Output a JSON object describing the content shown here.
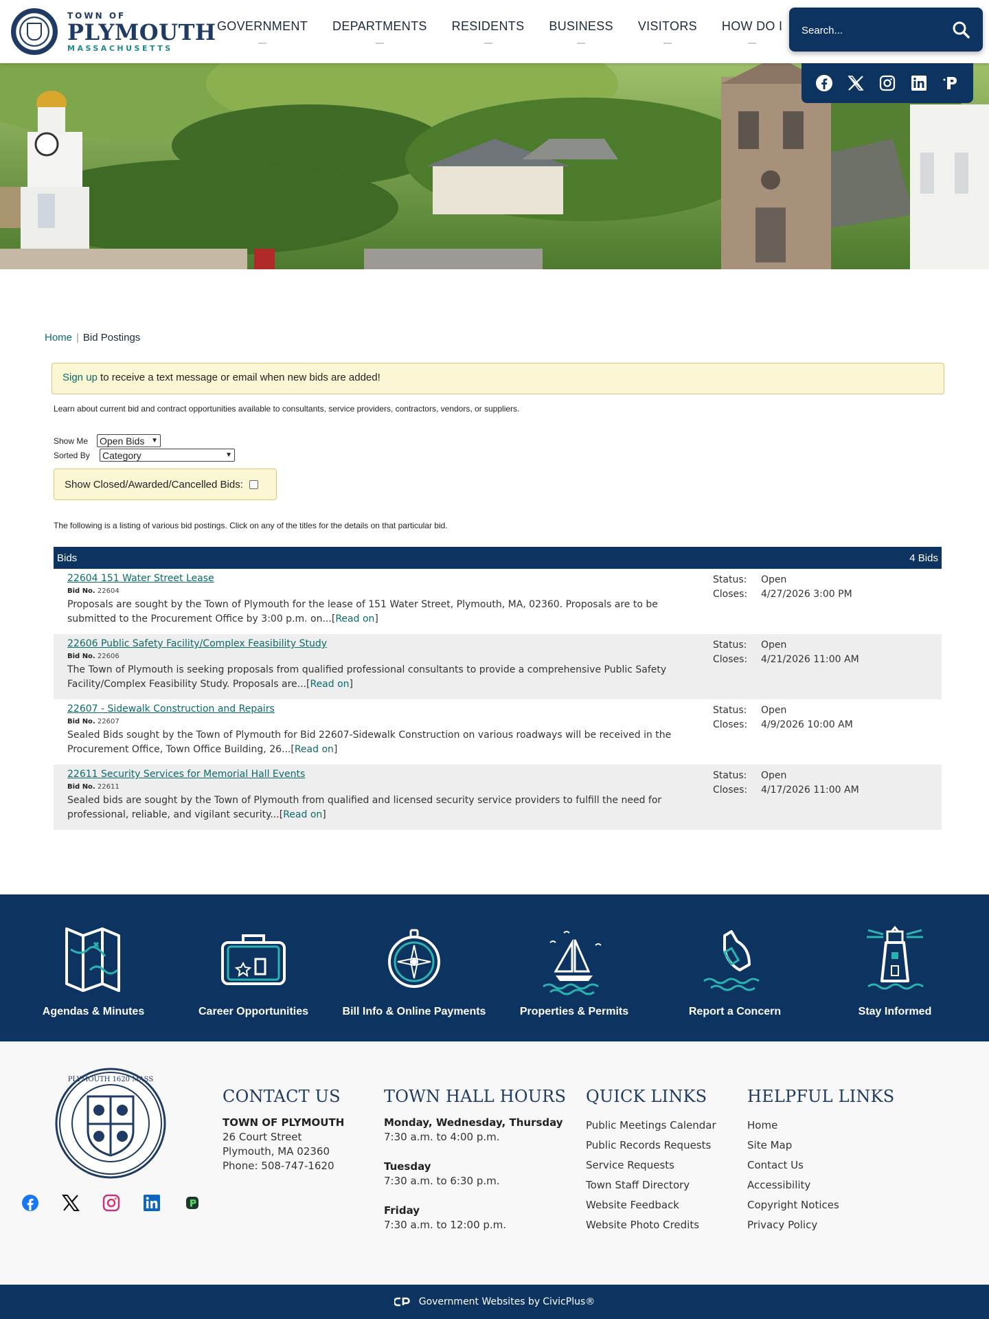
{
  "header": {
    "logo_town": "TOWN OF",
    "logo_name": "PLYMOUTH",
    "logo_state": "MASSACHUSETTS",
    "nav": [
      "GOVERNMENT",
      "DEPARTMENTS",
      "RESIDENTS",
      "BUSINESS",
      "VISITORS",
      "HOW DO I"
    ],
    "search_placeholder": "Search...",
    "social": [
      "facebook-icon",
      "x-icon",
      "instagram-icon",
      "linkedin-icon",
      "parking-app-icon"
    ]
  },
  "breadcrumb": {
    "home": "Home",
    "current": "Bid Postings"
  },
  "signup": {
    "link": "Sign up",
    "text": " to receive a text message or email when new bids are added!"
  },
  "intro": "Learn about current bid and contract opportunities available to consultants, service providers, contractors, vendors, or suppliers.",
  "filters": {
    "show_me_label": "Show Me",
    "show_me_value": "Open Bids",
    "sorted_by_label": "Sorted By",
    "sorted_by_value": "Category",
    "closed_label": "Show Closed/Awarded/Cancelled Bids:"
  },
  "listing_note": "The following is a listing of various bid postings. Click on any of the titles for the details on that particular bid.",
  "bids": {
    "header": "Bids",
    "count": "4 Bids",
    "bid_no_label": "Bid No.",
    "status_label": "Status:",
    "closes_label": "Closes:",
    "read_on": "Read on",
    "items": [
      {
        "title": "22604 151 Water Street Lease",
        "number": "22604",
        "desc": "Proposals are sought by the Town of Plymouth for the lease of 151 Water Street, Plymouth, MA, 02360. Proposals are to be submitted to the Procurement Office by 3:00 p.m. on...",
        "status": "Open",
        "closes": "4/27/2026 3:00 PM"
      },
      {
        "title": "22606 Public Safety Facility/Complex Feasibility Study",
        "number": "22606",
        "desc": "The Town of Plymouth is seeking proposals from qualified professional consultants to provide a comprehensive Public Safety Facility/Complex Feasibility Study. Proposals are...",
        "status": "Open",
        "closes": "4/21/2026 11:00 AM"
      },
      {
        "title": "22607 - Sidewalk Construction and Repairs",
        "number": "22607",
        "desc": "Sealed Bids sought by the Town of Plymouth for Bid 22607-Sidewalk Construction on various roadways will be received in the Procurement Office, Town Office Building, 26...",
        "status": "Open",
        "closes": "4/9/2026 10:00 AM"
      },
      {
        "title": "22611 Security Services for Memorial Hall Events",
        "number": "22611",
        "desc": "Sealed bids are sought by the Town of Plymouth from qualified and licensed security service providers to fulfill the need for professional, reliable, and vigilant security...",
        "status": "Open",
        "closes": "4/17/2026 11:00 AM"
      }
    ]
  },
  "quick_links": [
    {
      "label": "Agendas & Minutes",
      "icon": "map-icon"
    },
    {
      "label": "Career Opportunities",
      "icon": "suitcase-icon"
    },
    {
      "label": "Bill Info & Online Payments",
      "icon": "compass-icon"
    },
    {
      "label": "Properties & Permits",
      "icon": "sailboat-icon"
    },
    {
      "label": "Report a Concern",
      "icon": "message-bottle-icon"
    },
    {
      "label": "Stay Informed",
      "icon": "lighthouse-icon"
    }
  ],
  "footer": {
    "contact": {
      "heading": "CONTACT US",
      "org": "TOWN OF PLYMOUTH",
      "address1": "26 Court Street",
      "address2": "Plymouth, MA 02360",
      "phone": "Phone: 508-747-1620"
    },
    "hours": {
      "heading": "TOWN HALL HOURS",
      "d1": "Monday, Wednesday, Thursday",
      "h1": "7:30 a.m. to 4:00 p.m.",
      "d2": "Tuesday",
      "h2": "7:30 a.m. to 6:30 p.m.",
      "d3": "Friday",
      "h3": "7:30 a.m. to 12:00 p.m."
    },
    "quick": {
      "heading": "QUICK LINKS",
      "links": [
        "Public Meetings Calendar",
        "Public Records Requests",
        "Service Requests",
        "Town Staff Directory",
        "Website Feedback",
        "Website Photo Credits"
      ]
    },
    "helpful": {
      "heading": "HELPFUL LINKS",
      "links": [
        "Home",
        "Site Map",
        "Contact Us",
        "Accessibility",
        "Copyright Notices",
        "Privacy Policy"
      ]
    },
    "seal_text": "PLYMOUTH 1620 MASS",
    "social": [
      "facebook-icon",
      "x-icon",
      "instagram-icon",
      "linkedin-icon",
      "parking-app-icon"
    ]
  },
  "bottom": {
    "text": "Government Websites by ",
    "link": "CivicPlus®"
  },
  "colors": {
    "navy": "#0d3461",
    "teal": "#0b6b6b",
    "notice": "#fbf6d4"
  }
}
